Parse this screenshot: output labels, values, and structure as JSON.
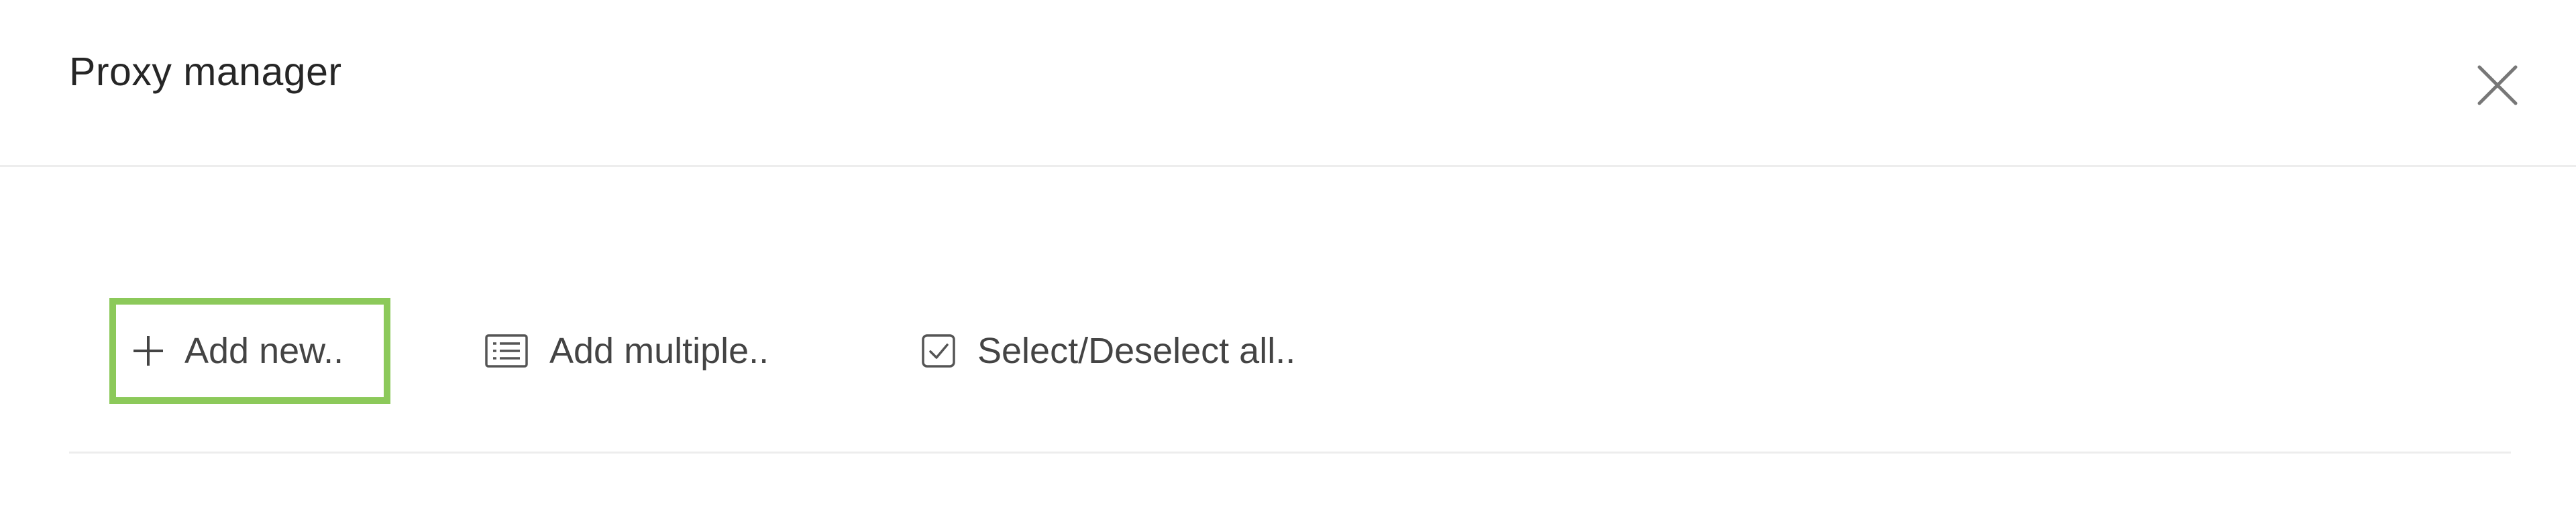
{
  "dialog": {
    "title": "Proxy manager",
    "close_icon": "close-icon"
  },
  "toolbar": {
    "add_new": {
      "label": "Add new..",
      "icon": "plus-icon"
    },
    "add_multiple": {
      "label": "Add multiple..",
      "icon": "list-icon"
    },
    "select_all": {
      "label": "Select/Deselect all..",
      "icon": "checkbox-checked-icon"
    }
  },
  "colors": {
    "highlight_border": "#8cc95a",
    "text": "#444444",
    "divider": "#ededed"
  }
}
